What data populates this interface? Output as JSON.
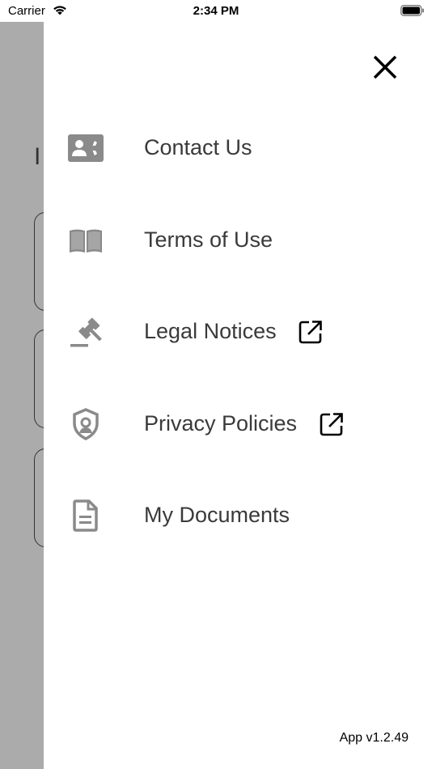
{
  "status_bar": {
    "carrier": "Carrier",
    "time": "2:34 PM",
    "wifi_icon": "wifi-icon",
    "battery_icon": "battery-icon"
  },
  "backdrop": {
    "peek_title": "I"
  },
  "drawer": {
    "close_icon": "close-icon",
    "menu": [
      {
        "label": "Contact Us",
        "icon": "contact-card-icon",
        "external": false
      },
      {
        "label": "Terms of Use",
        "icon": "open-book-icon",
        "external": false
      },
      {
        "label": "Legal Notices",
        "icon": "gavel-icon",
        "external": true
      },
      {
        "label": "Privacy Policies",
        "icon": "shield-icon",
        "external": true
      },
      {
        "label": "My Documents",
        "icon": "document-icon",
        "external": false
      }
    ],
    "version": "App v1.2.49"
  },
  "colors": {
    "icon_gray": "#8a8a8a",
    "label_text": "#3a3a3a",
    "backdrop": "#ababab"
  }
}
